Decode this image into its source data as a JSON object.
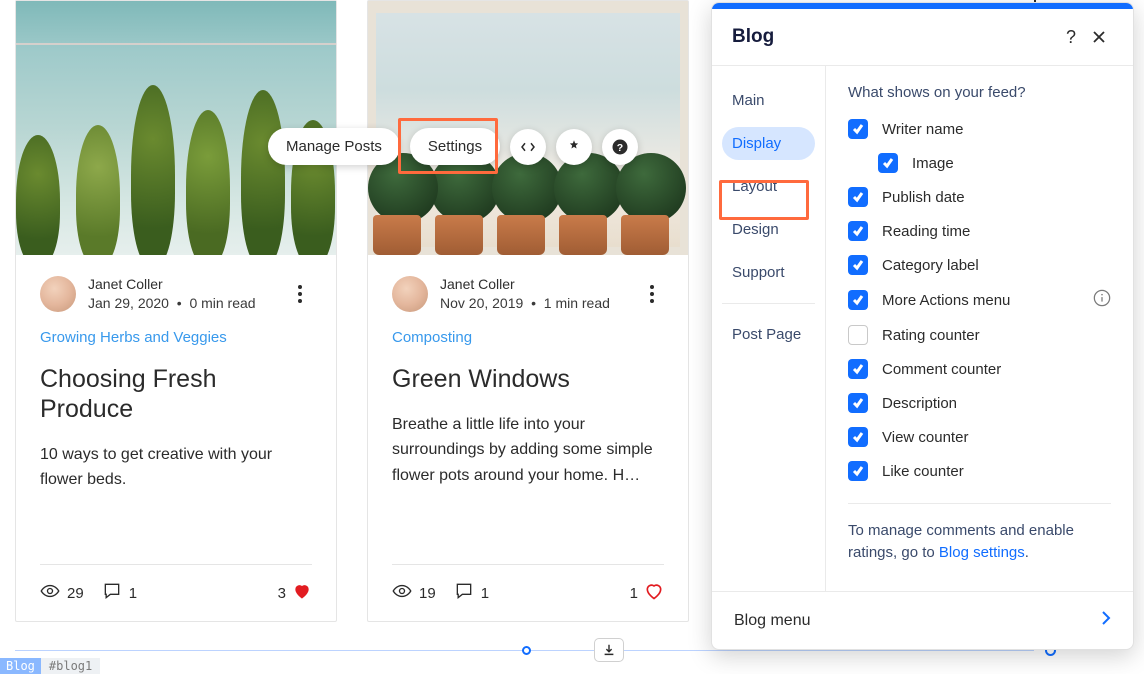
{
  "toolbar": {
    "manage_posts": "Manage Posts",
    "settings": "Settings"
  },
  "cards": [
    {
      "author": "Janet Coller",
      "date": "Jan 29, 2020",
      "read_time": "0 min read",
      "category": "Growing Herbs and Veggies",
      "title": "Choosing Fresh Produce",
      "excerpt": "10 ways to get creative with your flower beds.",
      "views": "29",
      "comments": "1",
      "likes": "3"
    },
    {
      "author": "Janet Coller",
      "date": "Nov 20, 2019",
      "read_time": "1 min read",
      "category": "Composting",
      "title": "Green Windows",
      "excerpt": "Breathe a little life into your surroundings by adding some simple flower pots around your home. H…",
      "views": "19",
      "comments": "1",
      "likes": "1"
    }
  ],
  "panel": {
    "title": "Blog",
    "nav": {
      "main": "Main",
      "display": "Display",
      "layout": "Layout",
      "design": "Design",
      "support": "Support",
      "post_page": "Post Page"
    },
    "section_title": "What shows on your feed?",
    "options": {
      "writer_name": "Writer name",
      "image": "Image",
      "publish_date": "Publish date",
      "reading_time": "Reading time",
      "category_label": "Category label",
      "more_actions": "More Actions menu",
      "rating_counter": "Rating counter",
      "comment_counter": "Comment counter",
      "description": "Description",
      "view_counter": "View counter",
      "like_counter": "Like counter"
    },
    "footer_note_prefix": "To manage comments and enable ratings, go to ",
    "footer_note_link": "Blog settings",
    "footer_note_suffix": ".",
    "blog_menu": "Blog menu"
  },
  "bottom": {
    "blog_tag": "Blog",
    "id_tag": "#blog1"
  }
}
